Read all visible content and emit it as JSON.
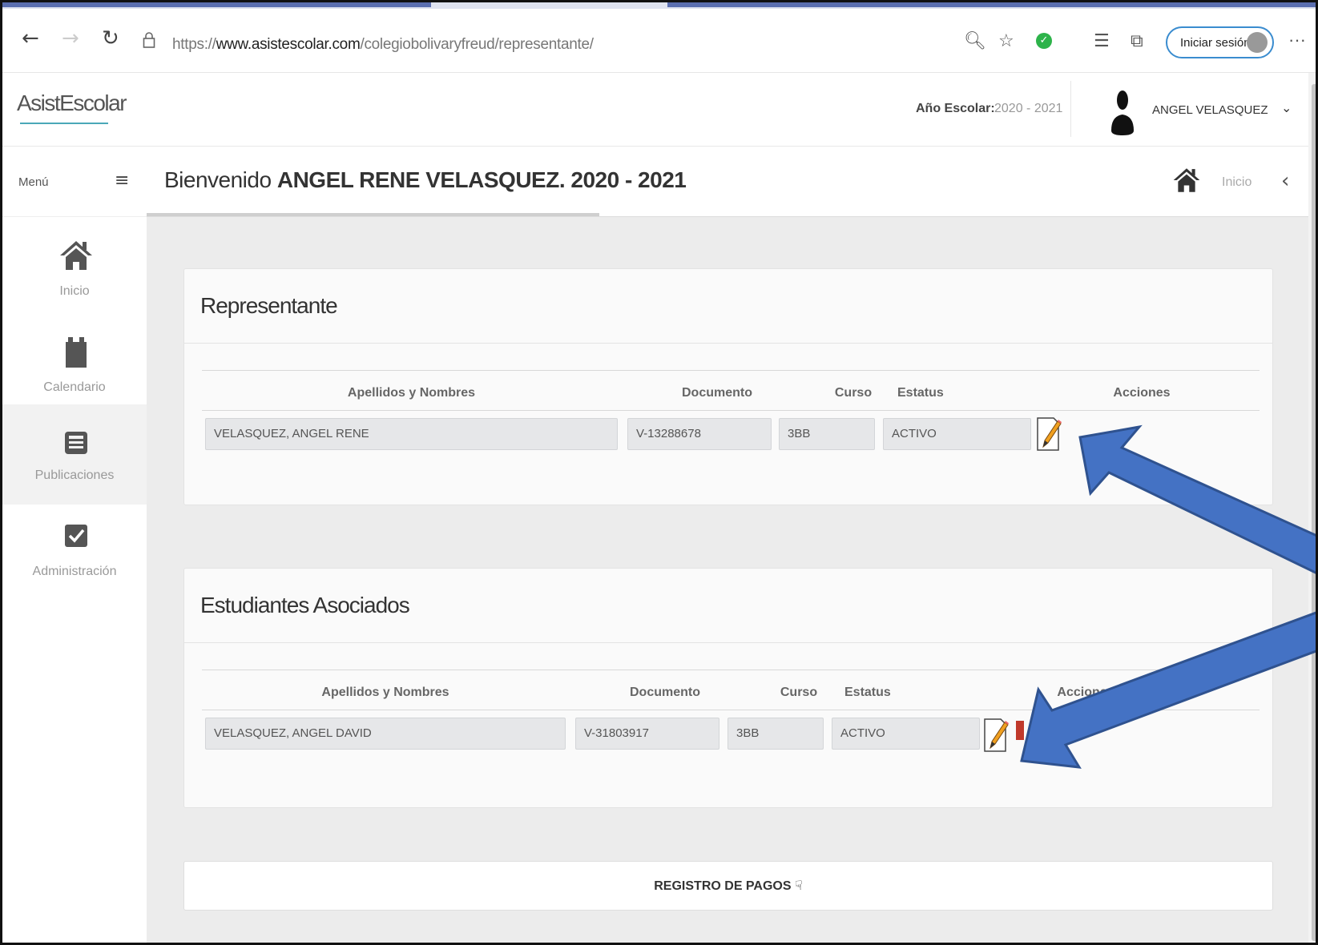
{
  "browser": {
    "back": "←",
    "forward": "→",
    "reload": "↻",
    "url_prefix": "https://",
    "url_domain": "www.asistescolar.com",
    "url_path": "/colegiobolivaryfreud/representante/",
    "signin_label": "Iniciar sesión",
    "more": "···"
  },
  "header": {
    "logo": "AsistEscolar",
    "school_year_label": "Año Escolar:",
    "school_year_value": "2020 - 2021",
    "user_name": "ANGEL VELASQUEZ",
    "user_menu_chevron": "⌄"
  },
  "sidebar": {
    "menu_label": "Menú",
    "toggle": "≡",
    "items": [
      {
        "label": "Inicio",
        "icon": "home-icon"
      },
      {
        "label": "Calendario",
        "icon": "calendar-icon"
      },
      {
        "label": "Publicaciones",
        "icon": "newspaper-icon"
      },
      {
        "label": "Administración",
        "icon": "checkbox-icon"
      }
    ]
  },
  "page": {
    "title_prefix": "Bienvenido ",
    "title_bold": "ANGEL RENE VELASQUEZ. 2020 - 2021",
    "breadcrumb": "Inicio",
    "back_chevron": "‹"
  },
  "representante": {
    "title": "Representante",
    "columns": [
      "Apellidos y Nombres",
      "Documento",
      "Curso",
      "Estatus",
      "Acciones"
    ],
    "row": {
      "nombre": "VELASQUEZ, ANGEL RENE",
      "documento": "V-13288678",
      "curso": "3BB",
      "estatus": "ACTIVO"
    }
  },
  "estudiantes": {
    "title": "Estudiantes Asociados",
    "columns": [
      "Apellidos y Nombres",
      "Documento",
      "Curso",
      "Estatus",
      "Acciones"
    ],
    "row": {
      "nombre": "VELASQUEZ, ANGEL DAVID",
      "documento": "V-31803917",
      "curso": "3BB",
      "estatus": "ACTIVO"
    }
  },
  "payments": {
    "label": "REGISTRO DE PAGOS"
  },
  "colors": {
    "arrow_fill": "#4472c4",
    "arrow_stroke": "#2f528f",
    "accent": "#3a8ccf"
  }
}
